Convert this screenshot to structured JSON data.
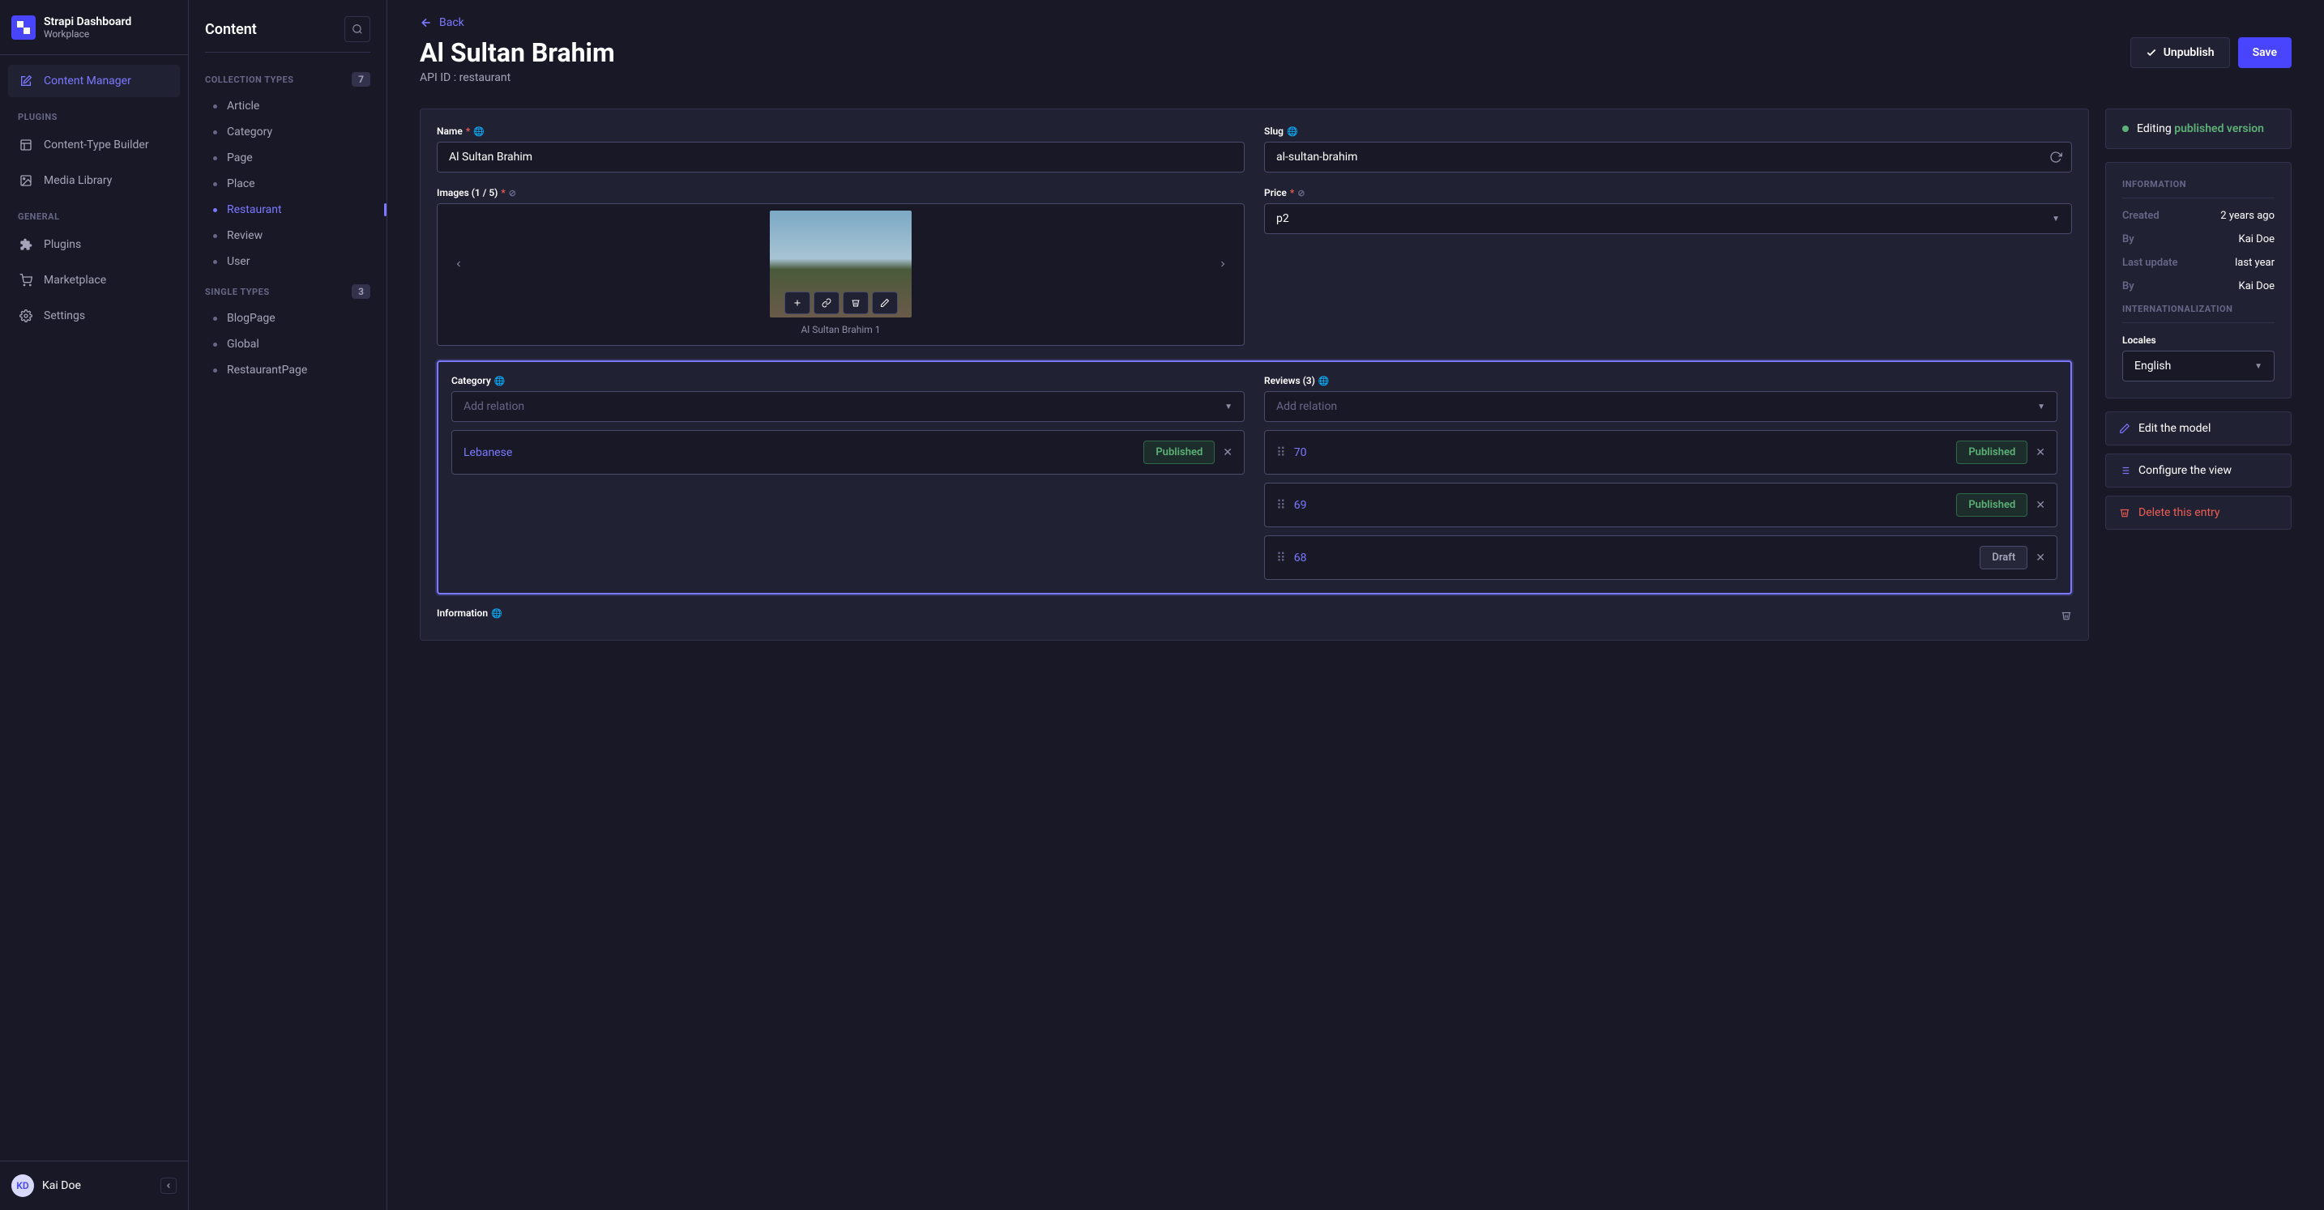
{
  "brand": {
    "title": "Strapi Dashboard",
    "subtitle": "Workplace"
  },
  "main_nav": {
    "content_manager": "Content Manager",
    "plugins_h": "Plugins",
    "ctb": "Content-Type Builder",
    "media": "Media Library",
    "general_h": "General",
    "plugins": "Plugins",
    "marketplace": "Marketplace",
    "settings": "Settings"
  },
  "user": {
    "initials": "KD",
    "name": "Kai Doe"
  },
  "sub": {
    "title": "Content",
    "collection_h": "Collection Types",
    "collection_count": "7",
    "single_h": "Single Types",
    "single_count": "3",
    "collection": [
      "Article",
      "Category",
      "Page",
      "Place",
      "Restaurant",
      "Review",
      "User"
    ],
    "single": [
      "BlogPage",
      "Global",
      "RestaurantPage"
    ]
  },
  "header": {
    "back": "Back",
    "title": "Al Sultan Brahim",
    "api_id": "API ID  : restaurant",
    "unpublish": "Unpublish",
    "save": "Save"
  },
  "form": {
    "name_label": "Name",
    "name_value": "Al Sultan Brahim",
    "slug_label": "Slug",
    "slug_value": "al-sultan-brahim",
    "images_label": "Images (1 / 5)",
    "image_caption": "Al Sultan Brahim 1",
    "price_label": "Price",
    "price_value": "p2",
    "category_label": "Category",
    "reviews_label": "Reviews (3)",
    "add_relation": "Add relation",
    "cat_items": [
      {
        "name": "Lebanese",
        "status": "Published"
      }
    ],
    "rev_items": [
      {
        "name": "70",
        "status": "Published"
      },
      {
        "name": "69",
        "status": "Published"
      },
      {
        "name": "68",
        "status": "Draft"
      }
    ],
    "info_component": "Information"
  },
  "side": {
    "editing": "Editing ",
    "published": "published version",
    "info_h": "Information",
    "created_k": "Created",
    "created_v": "2 years ago",
    "by1_k": "By",
    "by1_v": "Kai Doe",
    "updated_k": "Last update",
    "updated_v": "last year",
    "by2_k": "By",
    "by2_v": "Kai Doe",
    "intl_h": "Internationalization",
    "locales_k": "Locales",
    "locale_v": "English",
    "edit_model": "Edit the model",
    "configure": "Configure the view",
    "delete": "Delete this entry"
  }
}
